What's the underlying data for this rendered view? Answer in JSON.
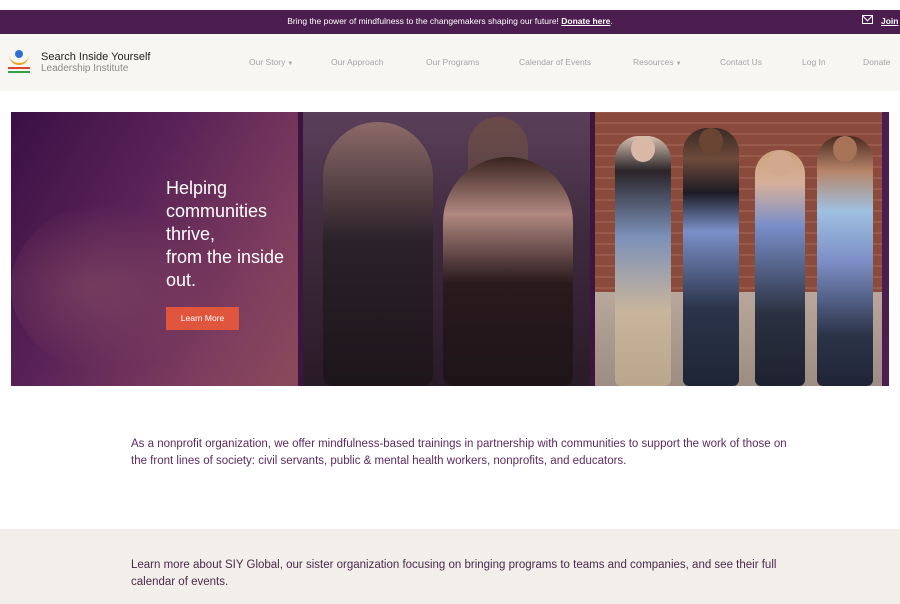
{
  "announcement": {
    "message": "Bring the power of mindfulness to the changemakers shaping our future!",
    "link_label": "Donate here",
    "suffix": ".",
    "join_label": "Join",
    "icon": "mail-icon"
  },
  "header": {
    "logo_line1": "Search Inside Yourself",
    "logo_line2": "Leadership Institute",
    "nav": [
      {
        "label": "Our Story",
        "dropdown": true
      },
      {
        "label": "Our Approach",
        "dropdown": false
      },
      {
        "label": "Our Programs",
        "dropdown": false
      },
      {
        "label": "Calendar of Events",
        "dropdown": false
      },
      {
        "label": "Resources",
        "dropdown": true
      },
      {
        "label": "Contact Us",
        "dropdown": false
      },
      {
        "label": "Log In",
        "dropdown": false
      },
      {
        "label": "Donate",
        "dropdown": false
      }
    ]
  },
  "hero": {
    "title_lines": [
      "Helping",
      "communities",
      "thrive,",
      "from the inside",
      "out."
    ],
    "button_label": "Learn More"
  },
  "mission": {
    "text": "As a nonprofit organization, we offer mindfulness-based trainings in partnership with communities to support the work of those on the front lines of society: civil servants, public & mental health workers, nonprofits, and educators."
  },
  "global": {
    "text": "Learn more about SIY Global, our sister organization focusing on bringing programs to teams and companies, and see their full calendar of events."
  },
  "colors": {
    "brand_purple": "#4c1d4f",
    "accent_orange": "#e0553d",
    "text_purple": "#5d2a5f"
  }
}
